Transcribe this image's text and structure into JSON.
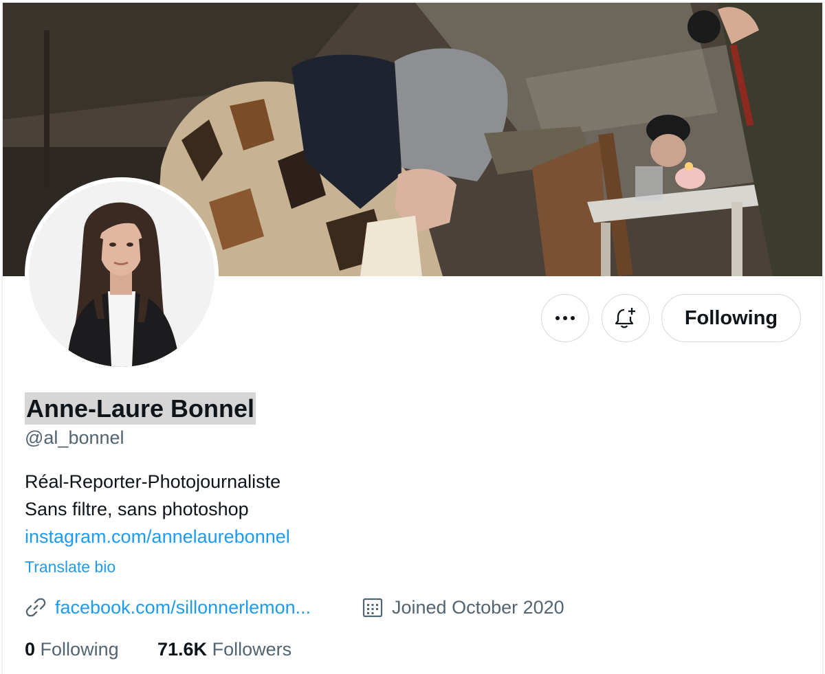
{
  "profile": {
    "name": "Anne-Laure Bonnel",
    "handle": "@al_bonnel",
    "bio_line1": "Réal-Reporter-Photojournaliste",
    "bio_line2": "Sans filtre, sans photoshop",
    "bio_link": "instagram.com/annelaurebonnel",
    "translate_label": "Translate bio",
    "website": "facebook.com/sillonnerlemon...",
    "joined": "Joined October 2020",
    "following_count": "0",
    "following_label": "Following",
    "followers_count": "71.6K",
    "followers_label": "Followers"
  },
  "actions": {
    "more_icon": "more-horizontal-icon",
    "notify_icon": "bell-plus-icon",
    "follow_label": "Following"
  },
  "icons": {
    "website": "link-icon",
    "joined": "calendar-icon"
  },
  "colors": {
    "accent": "#1d9bf0",
    "text_primary": "#0f1419",
    "text_secondary": "#536471",
    "border": "#cfd9de",
    "name_highlight": "#d6d6d6"
  }
}
